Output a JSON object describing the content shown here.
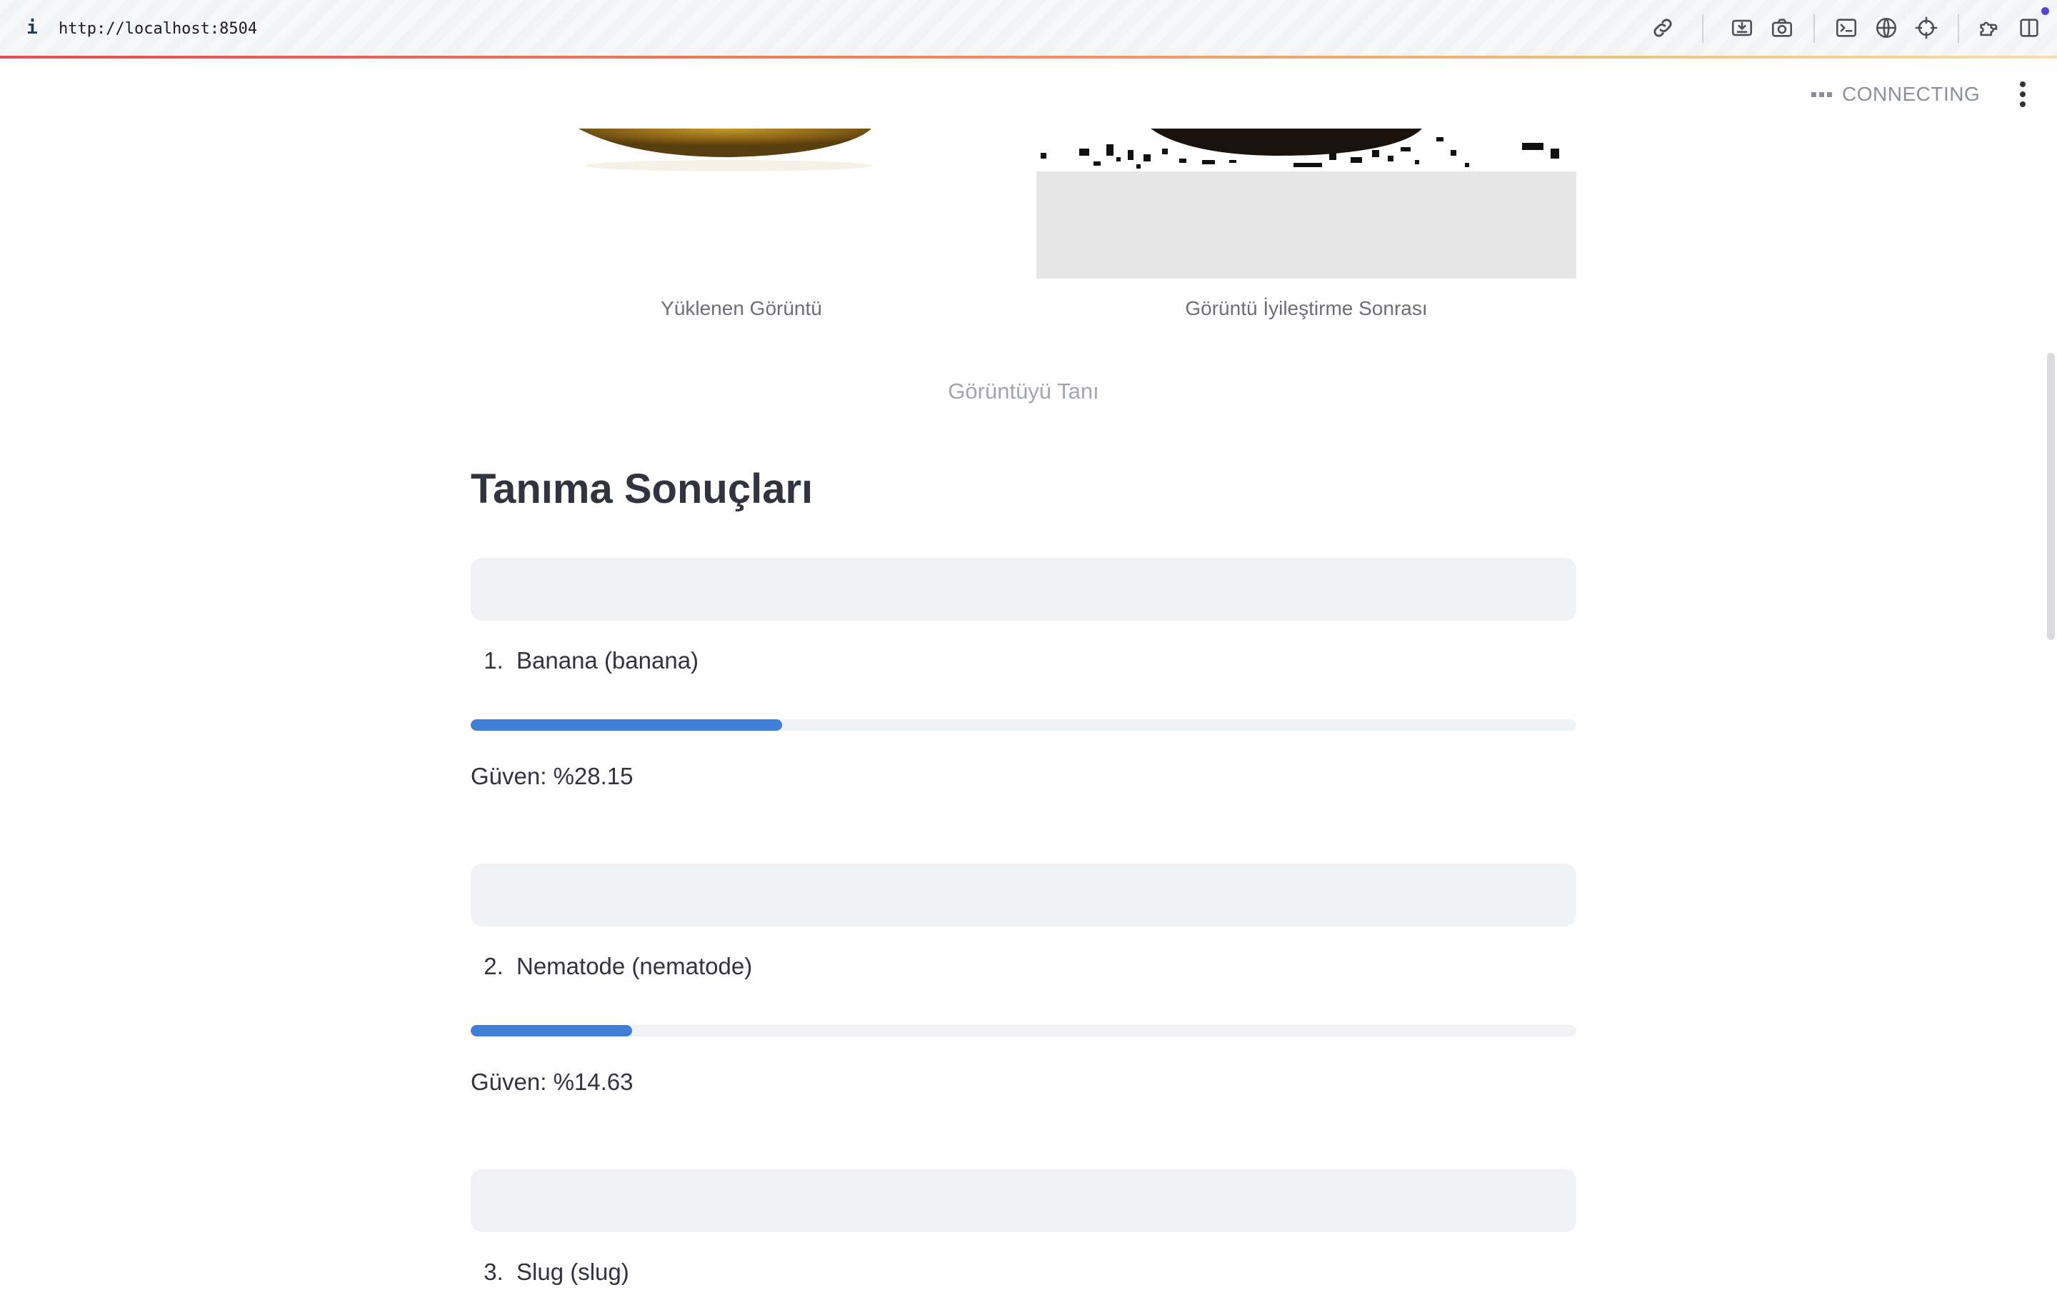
{
  "browser": {
    "url": "http://localhost:8504",
    "icons": [
      "info-icon",
      "link-icon",
      "inspect-icon",
      "camera-icon",
      "terminal-icon",
      "globe-icon",
      "crosshair-icon",
      "extensions-icon",
      "sidebar-icon"
    ]
  },
  "header": {
    "status_text": "CONNECTING",
    "menu_icon": "kebab-menu-icon"
  },
  "images": {
    "uploaded_caption": "Yüklenen Görüntü",
    "enhanced_caption": "Görüntü İyileştirme Sonrası"
  },
  "recognize_button": "Görüntüyü Tanı",
  "results": {
    "title": "Tanıma Sonuçları",
    "items": [
      {
        "rank": "1.",
        "label": "Banana (banana)",
        "confidence_text": "Güven: %28.15",
        "confidence": 0.2815
      },
      {
        "rank": "2.",
        "label": "Nematode (nematode)",
        "confidence_text": "Güven: %14.63",
        "confidence": 0.1463
      },
      {
        "rank": "3.",
        "label": "Slug (slug)"
      }
    ]
  },
  "colors": {
    "accent": "#3f7fd8",
    "box_bg": "#f0f2f6",
    "text": "#31333f"
  }
}
